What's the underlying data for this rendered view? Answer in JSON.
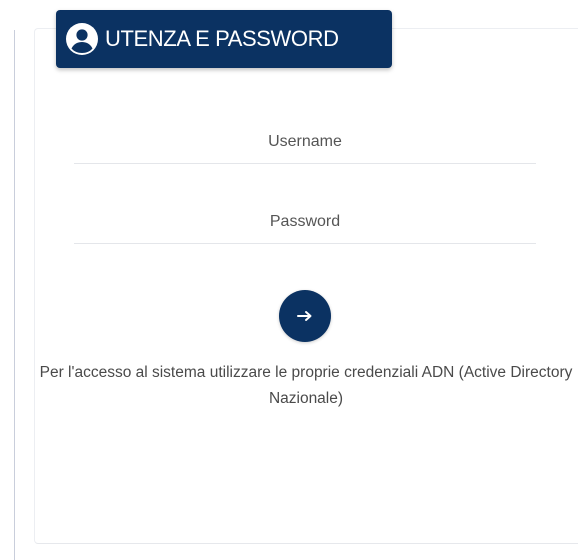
{
  "login": {
    "header": {
      "icon": "account-circle-icon",
      "title": "UTENZA E PASSWORD",
      "color": "#0b3262"
    },
    "username": {
      "placeholder": "Username",
      "value": ""
    },
    "password": {
      "placeholder": "Password",
      "value": ""
    },
    "submit": {
      "icon": "arrow-right-icon"
    },
    "info_text": "Per l'accesso al sistema utilizzare le proprie credenziali ADN (Active Directory Nazionale)"
  }
}
